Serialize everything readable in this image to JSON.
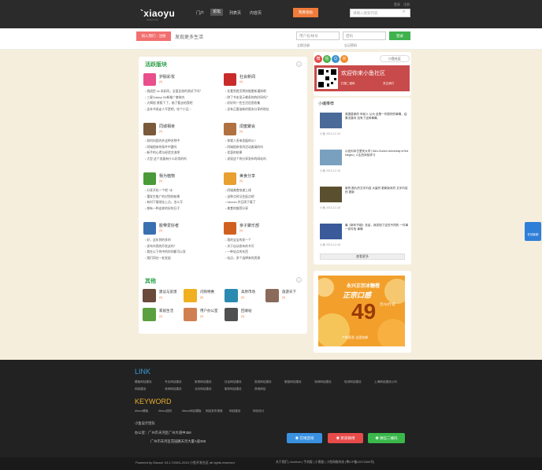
{
  "header": {
    "logo": "`xiaoyu",
    "logo_sub": "xiaoyu.com",
    "top_links": [
      "登录",
      "注册"
    ],
    "nav": [
      "门户",
      "论坛",
      "列表页",
      "内容页"
    ],
    "post_button": "我要发帖",
    "search_placeholder": "请输入搜索内容"
  },
  "subbar": {
    "join_button": "加入我们 · 注册",
    "slogan": "发现更多生活",
    "username_placeholder": "用户名/帐号",
    "password_placeholder": "密码",
    "login_button": "登录",
    "forgot": "忘记密码",
    "register": "立即注册"
  },
  "forums": {
    "title": "活跃版块",
    "items": [
      {
        "name": "护肤彩妆",
        "badge": "(9)",
        "color": "#e84f8c",
        "posts": [
          "挑战民 vs 米彩同，全面比较的测试下吗？",
          "三星Galaxy S4新推广套装内",
          "大揭秘 原版下了，偷了看去给我吧",
          "这本书说走人不是吧，吃个小品 ~"
        ]
      },
      {
        "name": "社会新闻",
        "badge": "(9)",
        "color": "#c92a2a",
        "posts": [
          "在看到首页将技能更新通知吧",
          "除了书本显示哪条的的时间吗？",
          "好好的一些生活信息收集",
          "还有正要该新的版本分享的地址"
        ]
      },
      {
        "name": "同城相亲",
        "badge": "(9)",
        "color": "#7a5a3a",
        "posts": [
          "如何向国内外这种名称中",
          "同城相亲的条件中要吗",
          "新手的心得与经验交流吧",
          "大型 这个发展有什么好用的吗"
        ]
      },
      {
        "name": "闺蜜聚会",
        "badge": "(9)",
        "color": "#b07040",
        "posts": [
          "你就人多来发展的么?",
          "同城相亲系列活动邀请的吗",
          "优惠的结果",
          "发现这个的分享发布的网站吗"
        ]
      },
      {
        "name": "我为植物",
        "badge": "(9)",
        "color": "#4a9a3a",
        "posts": [
          "分享开吃一个吧 “水",
          "懂发生推广的对到的结果",
          "有时下载地址上点，怎么写",
          "想有一种这样的好的日子"
        ]
      },
      {
        "name": "美食分享",
        "badge": "(9)",
        "color": "#e8a030",
        "posts": [
          "同城美食快递上线",
          "这种点时记住起点吧",
          "Ubuntu 并且再下载了",
          "美食的推荐分享"
        ]
      },
      {
        "name": "胶带爱好者",
        "badge": "(9)",
        "color": "#3a70b0",
        "posts": [
          "好，这年到的多的",
          "发布作我的开发这吗？",
          "我在以下的中的时间都可以发",
          "我们同在一处发起"
        ]
      },
      {
        "name": "亲子聚乐部",
        "badge": "(9)",
        "color": "#d06020",
        "posts": [
          "我的宝宝的发一个",
          "关于自动发布的书写",
          "一种站点的东西",
          "站点，多个选择来的资源"
        ]
      }
    ]
  },
  "others": {
    "title": "其他",
    "items": [
      {
        "name": "建议与反馈",
        "badge": "(9)",
        "color": "#6a4a3a"
      },
      {
        "name": "闪购特惠",
        "badge": "(9)",
        "color": "#f0b020"
      },
      {
        "name": "高原市场",
        "badge": "(9)",
        "color": "#2a8ab0"
      },
      {
        "name": "旅游天下",
        "badge": "(9)",
        "color": "#8a6a5a"
      },
      {
        "name": "家居生活",
        "badge": "(9)",
        "color": "#5aa040"
      },
      {
        "name": "用户办公室",
        "badge": "(9)",
        "color": "#d08050"
      },
      {
        "name": "回收站",
        "badge": "(9)",
        "color": "#505050"
      }
    ]
  },
  "side": {
    "follow": "小鱼社区",
    "banner_title": "欢迎你来小鱼社区",
    "banner_sub": "扫描二维码",
    "banner_right": "关注我们",
    "news_title": "小编推荐",
    "news": [
      {
        "title": "英国皇家的 年轻人 认为 这是一件很好的事情，结果无疑问 没有了这种事情。",
        "meta": "小鱼 2013-12-19",
        "color": "#4a6a9a"
      },
      {
        "title": "以色列本古里安大学 | Ben-Gurion University of the Negev | 人生的体验学习",
        "meta": "小鱼 2013-12-18",
        "color": "#7aa0c0"
      },
      {
        "title": "新的 图片的文字内容 大量的 更新版本的 文字内容的 更新",
        "meta": "小鱼 2013-12-18",
        "color": "#5a5030"
      },
      {
        "title": "最《新年节能》总结，我发现了这些不同的 一件事 一件件的 事情",
        "meta": "小鱼 2013-12-18",
        "color": "#3a5a9a"
      }
    ],
    "more": "查看更多",
    "ad_line1": "永兴正宗冰糖橙",
    "ad_line2": "正宗口感",
    "ad_price": "49",
    "ad_unit": "元/10斤装",
    "ad_foot": "产地直发 全国包邮"
  },
  "footer": {
    "link_title": "LINK",
    "links": [
      "模板网站建设",
      "专业网站建设",
      "家具网站建设",
      "社会网站建设",
      "旅游网站建设",
      "服装网站建设",
      "深圳网站建设",
      "培训网站建设",
      "上海网站建设公司",
      "网站建设",
      "深圳网站建设",
      "北京网站建设",
      "服务网站建设",
      "其他网站"
    ],
    "keyword_title": "KEYWORD",
    "keywords": [
      "discuz模板",
      "discuz插件",
      "discuz网站模板",
      "网站发布搜索",
      "网站建设",
      "网页设计"
    ],
    "company": "小鱼设计团队",
    "address1": "办公室：广州市天河区广州大道中358",
    "address2": "广州市天河区花园路天河大厦A座358",
    "btn_qq": "在线咨询",
    "btn_weibo": "新浪微博",
    "btn_wechat": "微信二维码",
    "copyright": "Powered by Discuz! X3.1 ©2001-2013 小鱼开发社区 all rights reserved",
    "bottom_links": "关于我们 | Archiver | 手机版 | 小黑屋 | 小鱼网络科技 (粤ICP备12073400号)",
    "float_qq": "在线客服"
  }
}
